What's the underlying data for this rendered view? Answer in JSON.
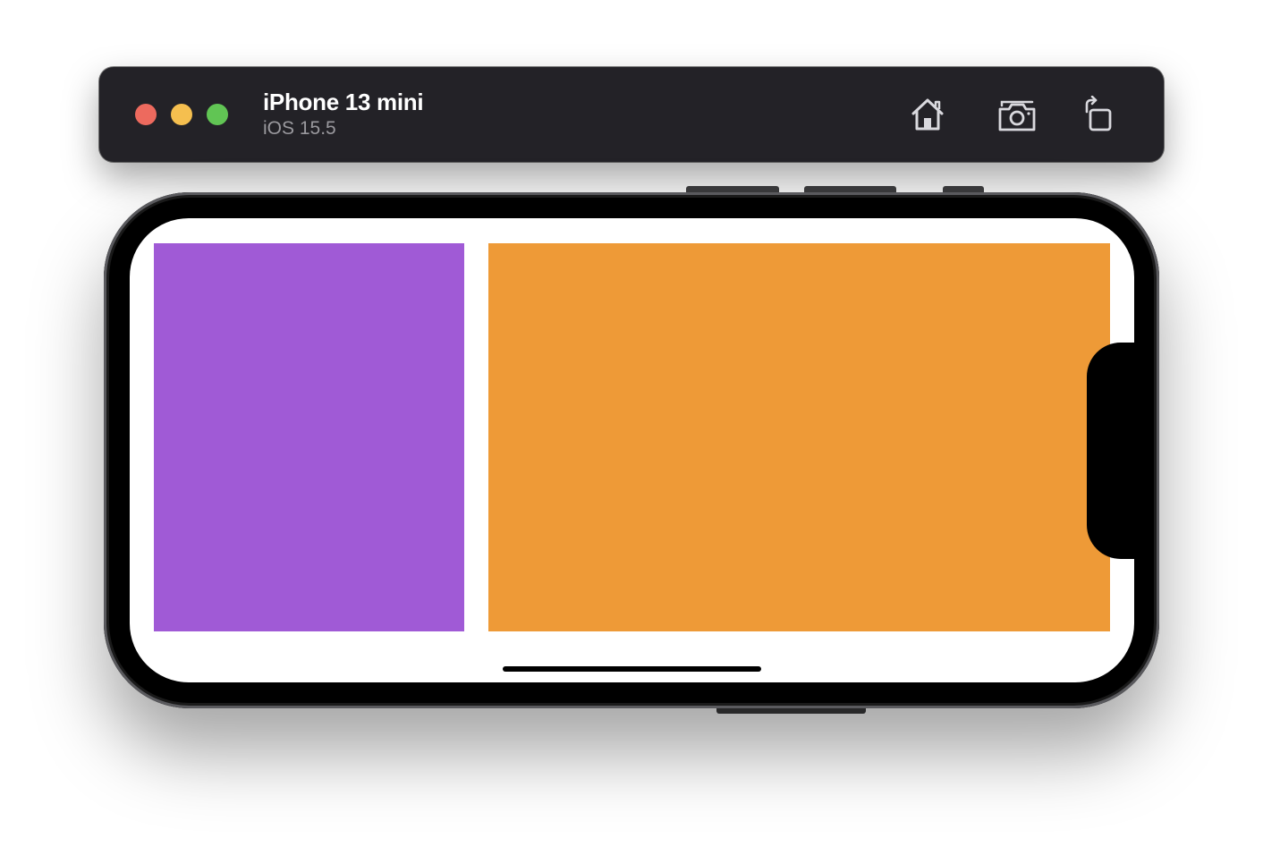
{
  "window": {
    "device_name": "iPhone 13 mini",
    "os_version": "iOS 15.5",
    "traffic_lights": {
      "close_color": "#ed6a5e",
      "minimize_color": "#f5bf4f",
      "zoom_color": "#61c554"
    },
    "toolbar": [
      {
        "name": "home-icon",
        "action": "Home"
      },
      {
        "name": "camera-icon",
        "action": "Screenshot"
      },
      {
        "name": "rotate-icon",
        "action": "Rotate"
      }
    ]
  },
  "screen": {
    "background": "#ffffff",
    "panels": [
      {
        "name": "purple-panel",
        "color": "#a05ad6"
      },
      {
        "name": "orange-panel",
        "color": "#ee9a37"
      }
    ],
    "home_indicator": true
  }
}
